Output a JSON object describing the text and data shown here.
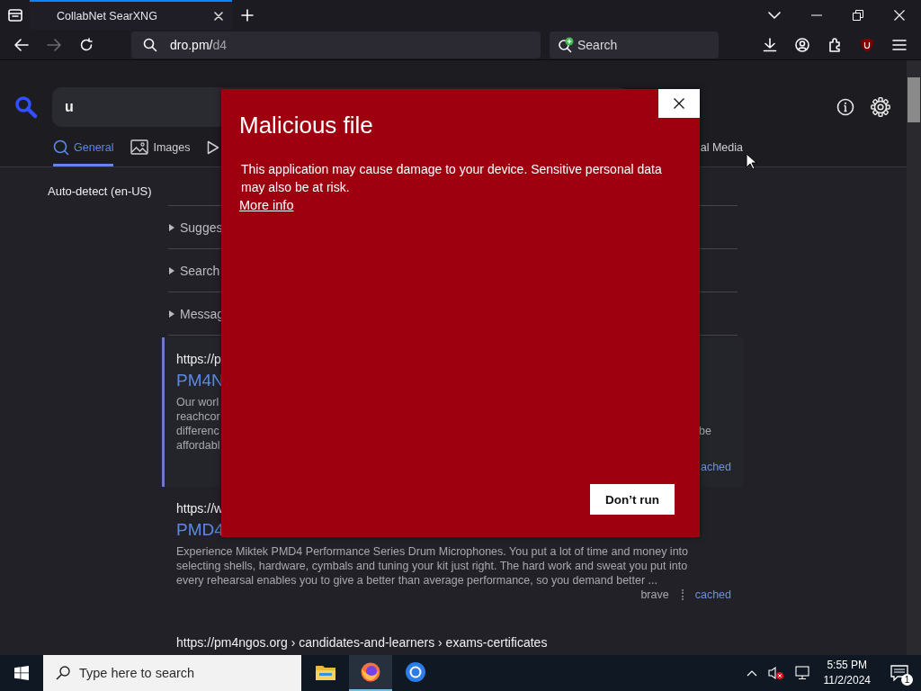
{
  "browser": {
    "tabs": [
      {
        "title": "CollabNet SearXNG",
        "selected": true
      }
    ],
    "nav": [
      {
        "kind": "back",
        "disabled": false
      },
      {
        "kind": "forward",
        "disabled": true
      },
      {
        "kind": "reload",
        "disabled": false
      }
    ],
    "address": {
      "host": "dro.pm/",
      "path": "d4"
    },
    "search_field": {
      "placeholder": "Search"
    }
  },
  "page": {
    "query": "u",
    "categories": [
      {
        "kind": "general",
        "label": "General",
        "selected": true
      },
      {
        "kind": "images",
        "label": "Images",
        "selected": false
      },
      {
        "kind": "videos",
        "selected": false
      },
      {
        "kind": "social",
        "label": "al Media",
        "selected": false
      }
    ],
    "language": "Auto-detect (en-US)",
    "panels": [
      {
        "label": "Sugges",
        "expanded": false
      },
      {
        "label": "Search",
        "expanded": false
      },
      {
        "label": "Messag",
        "expanded": false
      }
    ],
    "results": [
      {
        "url": "https://p",
        "title": "PM4N",
        "highlighted": true,
        "snippet_lines": [
          {
            "left": "Our worl"
          },
          {
            "left": "reachcor"
          },
          {
            "left": "differenc",
            "right": "be"
          },
          {
            "left": "affordabl"
          }
        ],
        "links": [
          "ached"
        ]
      },
      {
        "url": "https://w",
        "title": "PMD4",
        "highlighted": false,
        "snippet": "Experience Miktek PMD4 Performance Series Drum Microphones. You put a lot of time and money into selecting shells, hardware, cymbals and tuning your kit just right. The hard work and sweat you put into every rehearsal enables you to give a better than average performance, so you demand better ...",
        "engines": [
          "brave"
        ],
        "links": [
          "cached"
        ]
      },
      {
        "url": "https://pm4ngos.org  › candidates-and-learners › exams-certificates"
      }
    ]
  },
  "dialog": {
    "title": "Malicious file",
    "message": "This application may cause damage to your device. Sensitive personal data may also be at risk.",
    "link": "More info",
    "button": "Don’t run"
  },
  "taskbar": {
    "search_placeholder": "Type here to search",
    "apps": [
      {
        "kind": "explorer",
        "selected": false
      },
      {
        "kind": "firefox",
        "selected": true
      },
      {
        "kind": "chrome",
        "selected": false
      }
    ],
    "time": "5:55 PM",
    "date": "11/2/2024",
    "notifications": "1"
  }
}
